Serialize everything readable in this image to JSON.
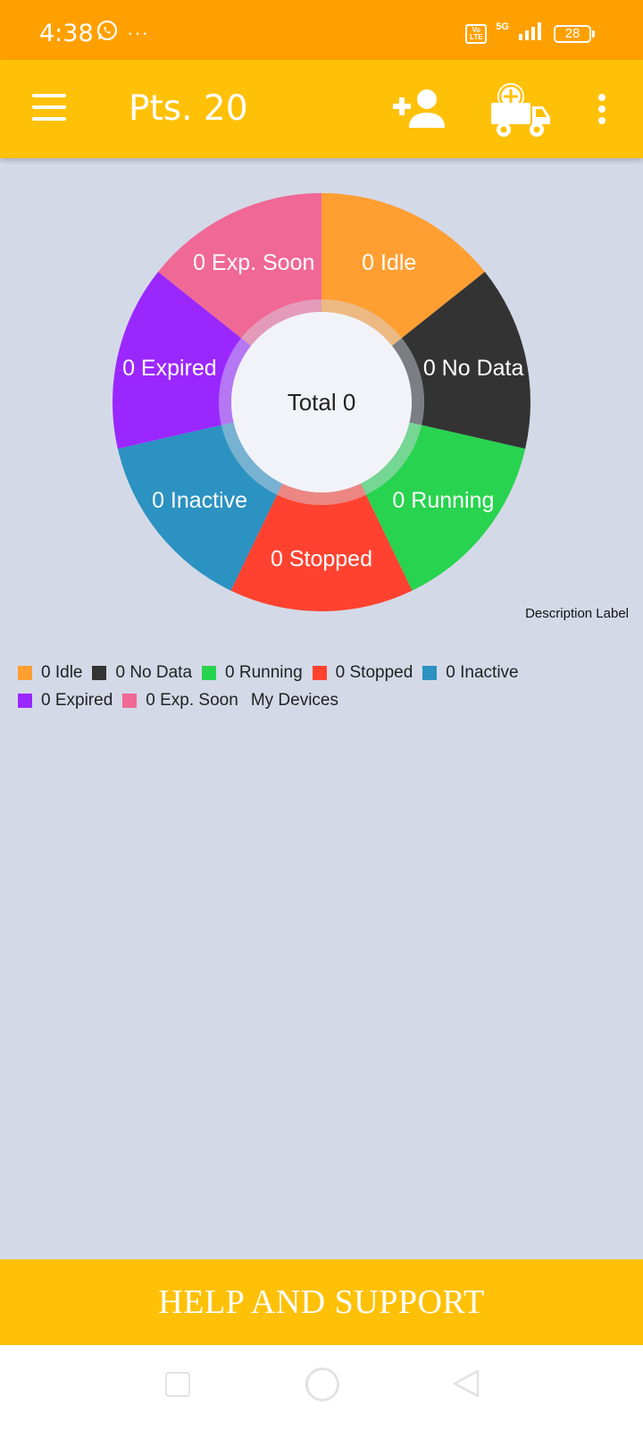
{
  "status_bar": {
    "time": "4:38",
    "more_dots": "···",
    "volte_label": "Vo LTE",
    "network_type": "5G",
    "battery_level": "28",
    "icons": [
      "whatsapp-icon",
      "signal-icon",
      "battery-icon"
    ]
  },
  "app_bar": {
    "title": "Pts. 20",
    "icons": [
      "menu-icon",
      "add-user-icon",
      "add-vehicle-icon",
      "more-vert-icon"
    ]
  },
  "chart_data": {
    "type": "pie",
    "style": "donut",
    "center_text": "Total 0",
    "description": "Description Label",
    "slices": [
      {
        "label": "0 Idle",
        "value": 0,
        "color": "#ff9f32"
      },
      {
        "label": "0 No Data",
        "value": 0,
        "color": "#333333"
      },
      {
        "label": "0 Running",
        "value": 0,
        "color": "#28d34f"
      },
      {
        "label": "0 Stopped",
        "value": 0,
        "color": "#ff4230"
      },
      {
        "label": "0 Inactive",
        "value": 0,
        "color": "#2b92c1"
      },
      {
        "label": "0 Expired",
        "value": 0,
        "color": "#9b27ff"
      },
      {
        "label": "0 Exp. Soon",
        "value": 0,
        "color": "#f06895"
      }
    ],
    "legend_title": "My Devices",
    "legend_placement": "bottom-left"
  },
  "legend": {
    "rows": [
      [
        {
          "label": "0 Idle",
          "color": "#ff9f32"
        },
        {
          "label": "0 No Data",
          "color": "#333333"
        },
        {
          "label": "0 Running",
          "color": "#28d34f"
        },
        {
          "label": "0 Stopped",
          "color": "#ff4230"
        },
        {
          "label": "0 Inactive",
          "color": "#2b92c1"
        }
      ],
      [
        {
          "label": "0 Expired",
          "color": "#9b27ff"
        },
        {
          "label": "0 Exp. Soon",
          "color": "#f06895"
        }
      ]
    ],
    "extra_label": "My Devices"
  },
  "footer": {
    "help_label": "HELP AND SUPPORT"
  },
  "nav_bar": {
    "icons": [
      "recent-apps-icon",
      "home-icon",
      "back-icon"
    ]
  },
  "colors": {
    "status_bar": "#ffa000",
    "app_bar": "#ffc107",
    "background": "#d4d9e7",
    "center_hole": "#f2f3f8"
  }
}
